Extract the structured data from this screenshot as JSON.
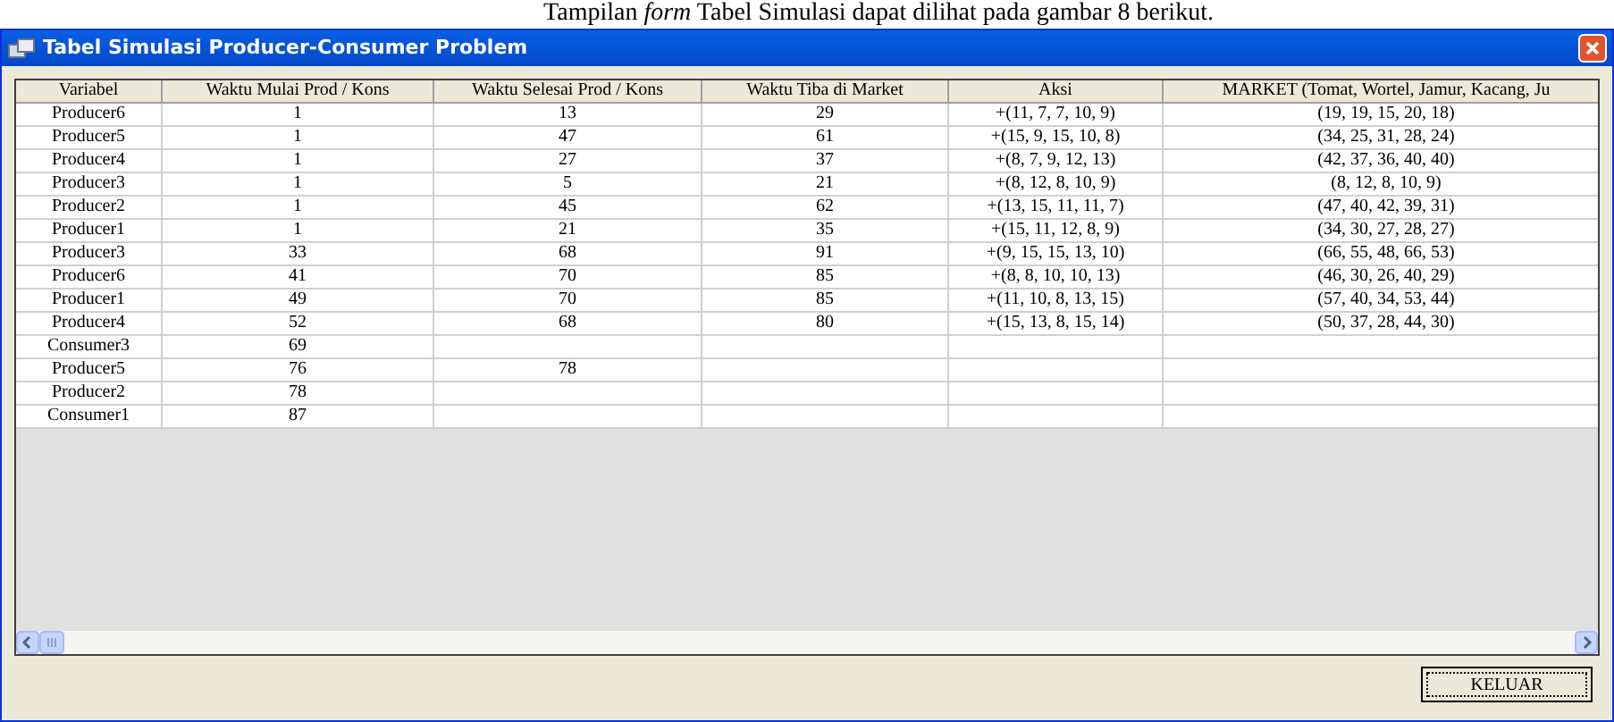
{
  "caption": "Tampilan *form* Tabel Simulasi dapat dilihat pada gambar 8 berikut.",
  "window": {
    "title": "Tabel Simulasi Producer-Consumer Problem"
  },
  "table": {
    "columns": [
      "Variabel",
      "Waktu Mulai Prod / Kons",
      "Waktu Selesai Prod / Kons",
      "Waktu Tiba di Market",
      "Aksi",
      "MARKET (Tomat, Wortel, Jamur, Kacang, Ju"
    ],
    "rows": [
      {
        "variabel": "Producer6",
        "mulai": "1",
        "selesai": "13",
        "tiba": "29",
        "aksi": "+(11, 7, 7, 10, 9)",
        "market": "(19, 19, 15, 20, 18)"
      },
      {
        "variabel": "Producer5",
        "mulai": "1",
        "selesai": "47",
        "tiba": "61",
        "aksi": "+(15, 9, 15, 10, 8)",
        "market": "(34, 25, 31, 28, 24)"
      },
      {
        "variabel": "Producer4",
        "mulai": "1",
        "selesai": "27",
        "tiba": "37",
        "aksi": "+(8, 7, 9, 12, 13)",
        "market": "(42, 37, 36, 40, 40)"
      },
      {
        "variabel": "Producer3",
        "mulai": "1",
        "selesai": "5",
        "tiba": "21",
        "aksi": "+(8, 12, 8, 10, 9)",
        "market": "(8, 12, 8, 10, 9)"
      },
      {
        "variabel": "Producer2",
        "mulai": "1",
        "selesai": "45",
        "tiba": "62",
        "aksi": "+(13, 15, 11, 11, 7)",
        "market": "(47, 40, 42, 39, 31)"
      },
      {
        "variabel": "Producer1",
        "mulai": "1",
        "selesai": "21",
        "tiba": "35",
        "aksi": "+(15, 11, 12, 8, 9)",
        "market": "(34, 30, 27, 28, 27)"
      },
      {
        "variabel": "Producer3",
        "mulai": "33",
        "selesai": "68",
        "tiba": "91",
        "aksi": "+(9, 15, 15, 13, 10)",
        "market": "(66, 55, 48, 66, 53)"
      },
      {
        "variabel": "Producer6",
        "mulai": "41",
        "selesai": "70",
        "tiba": "85",
        "aksi": "+(8, 8, 10, 10, 13)",
        "market": "(46, 30, 26, 40, 29)"
      },
      {
        "variabel": "Producer1",
        "mulai": "49",
        "selesai": "70",
        "tiba": "85",
        "aksi": "+(11, 10, 8, 13, 15)",
        "market": "(57, 40, 34, 53, 44)"
      },
      {
        "variabel": "Producer4",
        "mulai": "52",
        "selesai": "68",
        "tiba": "80",
        "aksi": "+(15, 13, 8, 15, 14)",
        "market": "(50, 37, 28, 44, 30)"
      },
      {
        "variabel": "Consumer3",
        "mulai": "69"
      },
      {
        "variabel": "Producer5",
        "mulai": "76",
        "selesai": "78"
      },
      {
        "variabel": "Producer2",
        "mulai": "78"
      },
      {
        "variabel": "Consumer1",
        "mulai": "87"
      }
    ]
  },
  "buttons": [
    "KELUAR"
  ]
}
